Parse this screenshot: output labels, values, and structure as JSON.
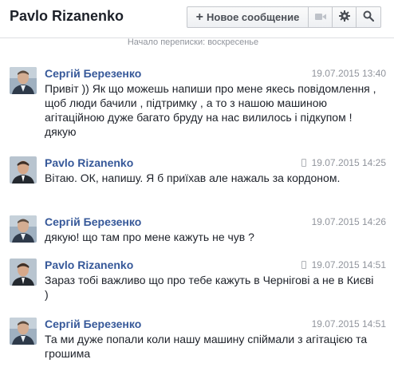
{
  "header": {
    "title": "Pavlo Rizanenko",
    "new_message_label": "Новое сообщение",
    "plus_icon": "plus-icon",
    "video_icon": "video-camera-icon",
    "gear_icon": "gear-icon",
    "search_icon": "search-icon"
  },
  "conversation_start": "Начало переписки: воскресенье",
  "messages": [
    {
      "sender": "Сергій Березенко",
      "time": "19.07.2015 13:40",
      "mobile": false,
      "text": "Привіт )) Як що можешь напиши про мене якесь повідомлення , щоб люди бачили , підтримку , а то з нашою машиною агітаційною дуже багато бруду на нас вилилось і підкупом !  дякую"
    },
    {
      "sender": "Pavlo Rizanenko",
      "time": "19.07.2015 14:25",
      "mobile": true,
      "text": "Вітаю. ОК, напишу. Я б приїхав але нажаль за кордоном."
    },
    {
      "sender": "Сергій Березенко",
      "time": "19.07.2015 14:26",
      "mobile": false,
      "text": "дякую! що там про мене кажуть не чув ?"
    },
    {
      "sender": "Pavlo Rizanenko",
      "time": "19.07.2015 14:51",
      "mobile": true,
      "text": "Зараз тобі важливо що про тебе кажуть в Чернігові а не в Києві )"
    },
    {
      "sender": "Сергій Березенко",
      "time": "19.07.2015 14:51",
      "mobile": false,
      "text": "Та ми дуже попали коли нашу машину спіймали з агітацією та грошима"
    }
  ]
}
